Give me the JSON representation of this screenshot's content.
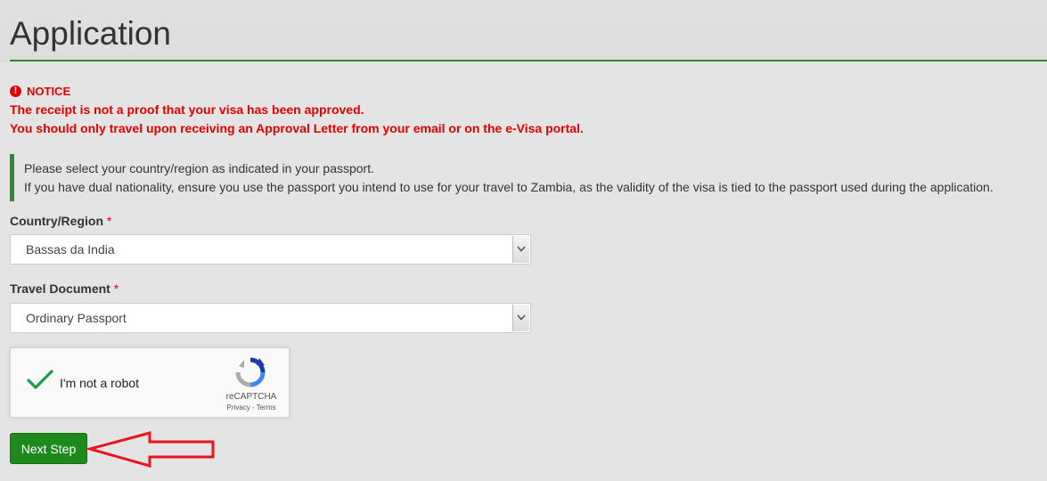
{
  "page": {
    "title": "Application"
  },
  "notice": {
    "heading": "NOTICE",
    "line1": "The receipt is not a proof that your visa has been approved.",
    "line2": "You should only travel upon receiving an Approval Letter from your email or on the e-Visa portal."
  },
  "info": {
    "line1": "Please select your country/region as indicated in your passport.",
    "line2": "If you have dual nationality, ensure you use the passport you intend to use for your travel to Zambia, as the validity of the visa is tied to the passport used during the application."
  },
  "form": {
    "country": {
      "label": "Country/Region",
      "required_mark": "*",
      "value": "Bassas da India"
    },
    "document": {
      "label": "Travel Document",
      "required_mark": "*",
      "value": "Ordinary Passport"
    }
  },
  "recaptcha": {
    "label": "I'm not a robot",
    "brand": "reCAPTCHA",
    "links": "Privacy - Terms",
    "checked": true
  },
  "actions": {
    "next_label": "Next Step"
  },
  "colors": {
    "accent_green": "#2e8b2e",
    "notice_red": "#e00000",
    "annotation_red": "#e8141e"
  },
  "icons": {
    "notice": "exclamation-circle-icon",
    "select_arrow": "chevron-down-icon",
    "recaptcha_check": "checkmark-icon",
    "recaptcha_logo": "recaptcha-logo-icon",
    "annotation": "red-arrow-pointer"
  }
}
